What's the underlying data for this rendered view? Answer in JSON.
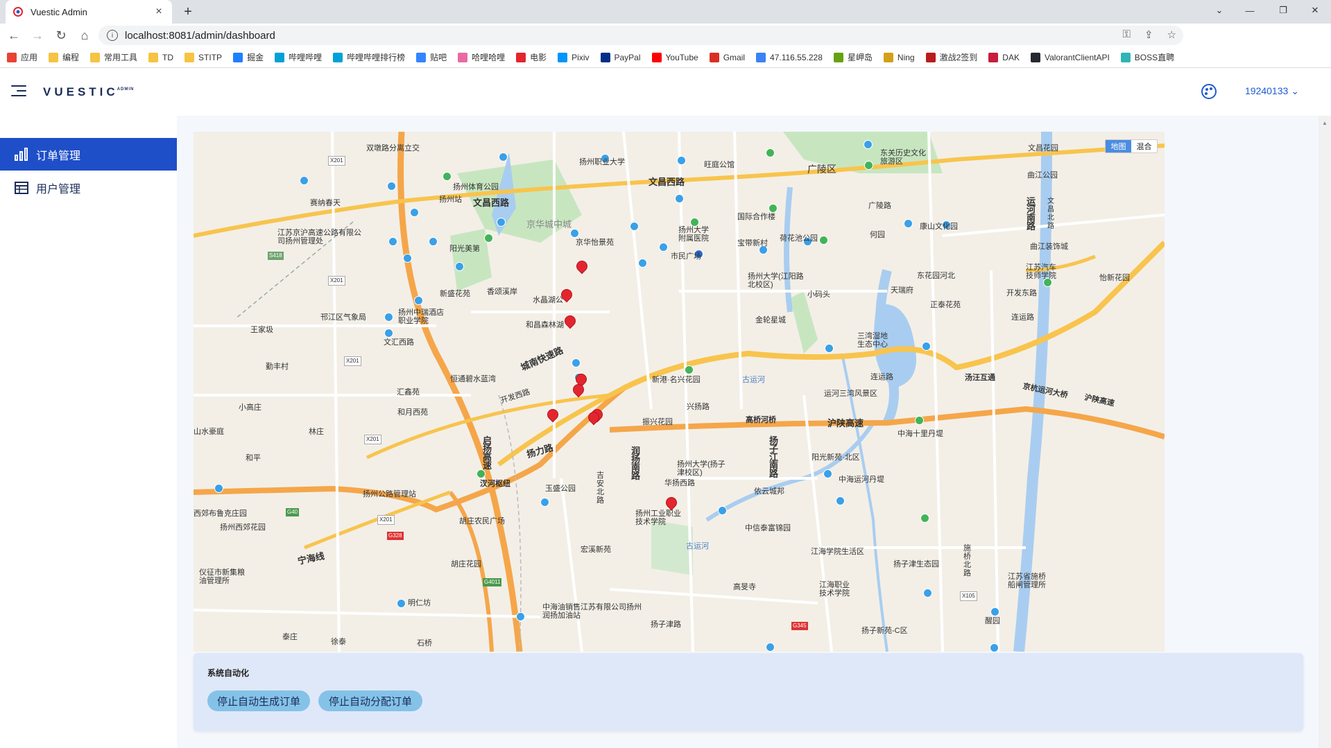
{
  "browser": {
    "tab_title": "Vuestic Admin",
    "tab_close": "×",
    "new_tab": "+",
    "url": "localhost:8081/admin/dashboard",
    "window_minimize": "—",
    "window_restore": "❐",
    "window_close": "✕"
  },
  "bookmarks": [
    {
      "label": "应用",
      "color": "#e94235"
    },
    {
      "label": "编程",
      "color": "#f6c443"
    },
    {
      "label": "常用工具",
      "color": "#f6c443"
    },
    {
      "label": "TD",
      "color": "#f6c443"
    },
    {
      "label": "STITP",
      "color": "#f6c443"
    },
    {
      "label": "掘金",
      "color": "#1e80ff"
    },
    {
      "label": "哔哩哔哩",
      "color": "#00a1d6"
    },
    {
      "label": "哔哩哔哩排行榜",
      "color": "#00a1d6"
    },
    {
      "label": "贴吧",
      "color": "#3385ff"
    },
    {
      "label": "哈哩哈哩",
      "color": "#e96aa3"
    },
    {
      "label": "电影",
      "color": "#e4252f"
    },
    {
      "label": "Pixiv",
      "color": "#0096fa"
    },
    {
      "label": "PayPal",
      "color": "#003087"
    },
    {
      "label": "YouTube",
      "color": "#ff0000"
    },
    {
      "label": "Gmail",
      "color": "#d93025"
    },
    {
      "label": "47.116.55.228",
      "color": "#3b82f6"
    },
    {
      "label": "星岬岛",
      "color": "#65a30d"
    },
    {
      "label": "Ning",
      "color": "#d4a017"
    },
    {
      "label": "激战2签到",
      "color": "#b91c1c"
    },
    {
      "label": "DAK",
      "color": "#c81e3c"
    },
    {
      "label": "ValorantClientAPI",
      "color": "#24292f"
    },
    {
      "label": "BOSS直聘",
      "color": "#31b4b4"
    }
  ],
  "app": {
    "logo": "VUESTIC",
    "logo_sub": "ADMIN",
    "user": "19240133",
    "user_caret": "⌄",
    "accent": "#1e4fc9"
  },
  "sidebar": {
    "items": [
      {
        "label": "订单管理",
        "active": true,
        "icon": "bar-chart-icon"
      },
      {
        "label": "用户管理",
        "active": false,
        "icon": "table-icon"
      }
    ]
  },
  "map": {
    "type_map": "地图",
    "type_hybrid": "混合",
    "labels": {
      "l1": "双墩路分离立交",
      "l2": "扬州职业大学",
      "l3": "旺庭公馆",
      "l4": "广陵区",
      "l5": "东关历史文化旅游区",
      "l6": "文昌花园",
      "l7": "曲江公园",
      "l8": "文昌西路",
      "l9": "文昌西路",
      "l10": "扬州体育公园",
      "l11": "扬州站",
      "l12": "赛纳春天",
      "l13": "京华城中城",
      "l14": "江苏京沪高速公路有限公司扬州管理处",
      "l15": "阳光美第",
      "l16": "扬州大学附属医院",
      "l17": "国际合作楼",
      "l18": "广陵路",
      "l19": "康山文化园",
      "l20": "京华怡景苑",
      "l21": "宝带新村",
      "l22": "荷花池公园",
      "l23": "市民广场",
      "l24": "何园",
      "l25": "曲江装饰城",
      "l26": "运河南路",
      "l27": "扬州大学(江阳路北校区)",
      "l28": "东花园河北",
      "l29": "江苏汽车技师学院",
      "l30": "怡新花园",
      "l31": "新盛花苑",
      "l32": "香颂溪岸",
      "l33": "水晶湖公",
      "l34": "小码头",
      "l35": "天瑞府",
      "l36": "正泰花苑",
      "l37": "开发东路",
      "l38": "邗江区气象局",
      "l39": "扬州中瑞酒店职业学院",
      "l40": "和昌森林湖",
      "l41": "金轮星城",
      "l42": "连运路",
      "l43": "王家圾",
      "l44": "文汇西路",
      "l45": "三湾湿地生态中心",
      "l46": "城南快速路",
      "l47": "勤丰村",
      "l48": "恒通碧水蓝湾",
      "l49": "新港·名兴花园",
      "l50": "古运河",
      "l51": "连运路",
      "l52": "汤汪互通",
      "l53": "京杭运河大桥",
      "l54": "沪陕高速",
      "l55": "汇鑫苑",
      "l56": "开发西路",
      "l57": "运河三湾风景区",
      "l58": "小高庄",
      "l59": "和月西苑",
      "l60": "兴扬路",
      "l61": "振兴花园",
      "l62": "高桥河桥",
      "l63": "沪陕高速",
      "l64": "中海十里丹堤",
      "l65": "山水豪庭",
      "l66": "林庄",
      "l67": "启扬高速",
      "l68": "扬力路",
      "l69": "润扬南路",
      "l70": "扬子江南路",
      "l71": "扬州大学(扬子津校区)",
      "l72": "阳光新苑·北区",
      "l73": "和平",
      "l74": "汊河枢纽",
      "l75": "华扬西路",
      "l76": "中海运河丹堤",
      "l77": "扬州公路管理站",
      "l78": "玉盛公园",
      "l79": "吉安北路",
      "l80": "依云城邦",
      "l81": "西郊布鲁克庄园",
      "l82": "扬州西郊花园",
      "l83": "胡庄农民广场",
      "l84": "扬州工业职业技术学院",
      "l85": "中信泰富锦园",
      "l86": "宁海线",
      "l87": "宏溪新苑",
      "l88": "古运河",
      "l89": "江海学院生活区",
      "l90": "施桥北路",
      "l91": "胡庄花园",
      "l92": "扬子津生态园",
      "l93": "仪征市新集粮油管理所",
      "l94": "高旻寺",
      "l95": "江海职业技术学院",
      "l96": "江苏省施桥船闸管理所",
      "l97": "明仁坊",
      "l98": "中海油销售江苏有限公司扬州润扬加油站",
      "l99": "醒园",
      "l100": "扬子津路",
      "l101": "泰庄",
      "l102": "徐泰",
      "l103": "石桥",
      "l104": "扬子新苑-C区",
      "l105": "文昌北路"
    },
    "shields": {
      "s1": "X201",
      "s2": "S418",
      "s3": "X201",
      "s4": "X201",
      "s5": "X201",
      "s6": "G40",
      "s7": "G328",
      "s8": "X201",
      "s9": "G4011",
      "s10": "G345",
      "s11": "X105"
    },
    "marker_color": "#e4252f"
  },
  "automation": {
    "title": "系统自动化",
    "btn_stop_generate": "停止自动生成订单",
    "btn_stop_assign": "停止自动分配订单"
  }
}
